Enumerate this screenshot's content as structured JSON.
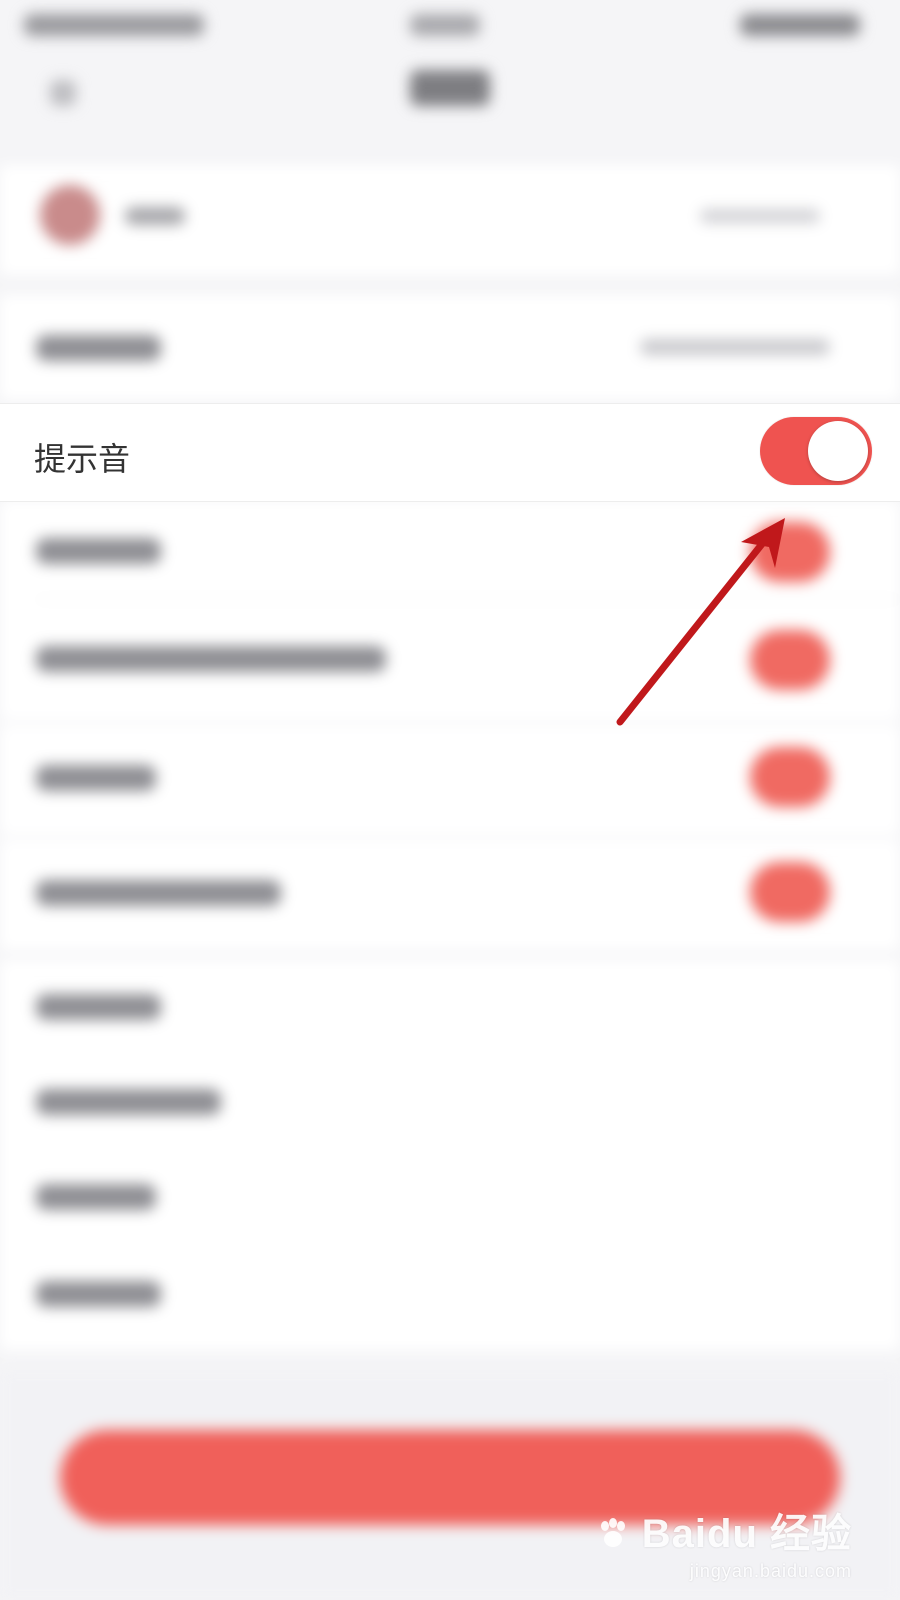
{
  "setting_row": {
    "label": "提示音",
    "toggle_on": true
  },
  "colors": {
    "accent": "#ef5350",
    "arrow": "#c0181b",
    "background": "#f5f5f7"
  },
  "watermark": {
    "brand": "Baidu 经验",
    "url": "jingyan.baidu.com"
  }
}
